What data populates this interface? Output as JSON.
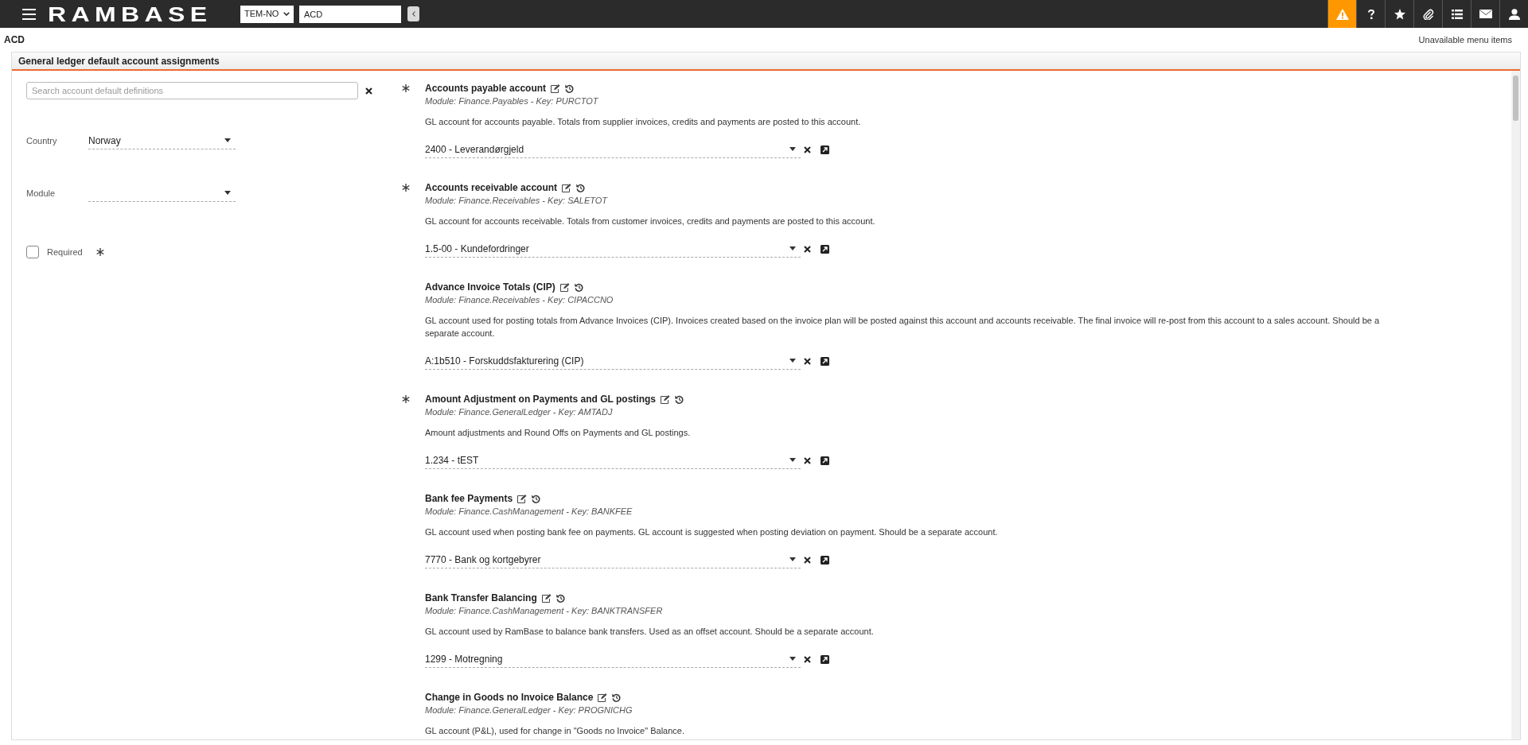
{
  "top_bar": {
    "logo": "RAMBASE",
    "company": "TEM-NO",
    "search_value": "ACD",
    "toolbar_buttons": [
      {
        "kind": "alerts",
        "highlighted": true
      },
      {
        "kind": "help",
        "highlighted": false
      },
      {
        "kind": "favorites",
        "highlighted": false
      },
      {
        "kind": "attachments",
        "highlighted": false
      },
      {
        "kind": "list",
        "highlighted": false
      },
      {
        "kind": "messages",
        "highlighted": false
      },
      {
        "kind": "user",
        "highlighted": false
      }
    ]
  },
  "page": {
    "title": "ACD",
    "menu_link": "Unavailable menu items"
  },
  "panel": {
    "title": "General ledger default account assignments"
  },
  "filters": {
    "search": {
      "placeholder": "Search account default definitions"
    },
    "country": {
      "label": "Country",
      "value": "Norway"
    },
    "module": {
      "label": "Module"
    },
    "required": {
      "label": "Required",
      "checked": false
    }
  },
  "accounts": [
    {
      "title": "Accounts payable account",
      "module_key": "Module: Finance.Payables - Key: PURCTOT",
      "description": "GL account for accounts payable. Totals from supplier invoices, credits and payments are posted to this account.",
      "value": "2400 - Leverandørgjeld",
      "required": true
    },
    {
      "title": "Accounts receivable account",
      "module_key": "Module: Finance.Receivables - Key: SALETOT",
      "description": "GL account for accounts receivable. Totals from customer invoices, credits and payments are posted to this account.",
      "value": "1.5-00 - Kundefordringer",
      "required": true
    },
    {
      "title": "Advance Invoice Totals (CIP)",
      "module_key": "Module: Finance.Receivables - Key: CIPACCNO",
      "description": "GL account used for posting totals from Advance Invoices (CIP). Invoices created based on the invoice plan will be posted against this account and accounts receivable. The final invoice will re-post from this account to a sales account. Should be a separate account.",
      "value": "A:1b510 - Forskuddsfakturering (CIP)",
      "required": false
    },
    {
      "title": "Amount Adjustment on Payments and GL postings",
      "module_key": "Module: Finance.GeneralLedger - Key: AMTADJ",
      "description": "Amount adjustments and Round Offs on Payments and GL postings.",
      "value": "1.234 - tEST",
      "required": true
    },
    {
      "title": "Bank fee Payments",
      "module_key": "Module: Finance.CashManagement - Key: BANKFEE",
      "description": "GL account used when posting bank fee on payments. GL account is suggested when posting deviation on payment. Should be a separate account.",
      "value": "7770 - Bank og kortgebyrer",
      "required": false
    },
    {
      "title": "Bank Transfer Balancing",
      "module_key": "Module: Finance.CashManagement - Key: BANKTRANSFER",
      "description": "GL account used by RamBase to balance bank transfers. Used as an offset account. Should be a separate account.",
      "value": "1299 - Motregning",
      "required": false
    },
    {
      "title": "Change in Goods no Invoice Balance",
      "module_key": "Module: Finance.GeneralLedger - Key: PROGNICHG",
      "description": "GL account (P&L), used for change in \"Goods no Invoice\" Balance.",
      "required": false
    }
  ]
}
